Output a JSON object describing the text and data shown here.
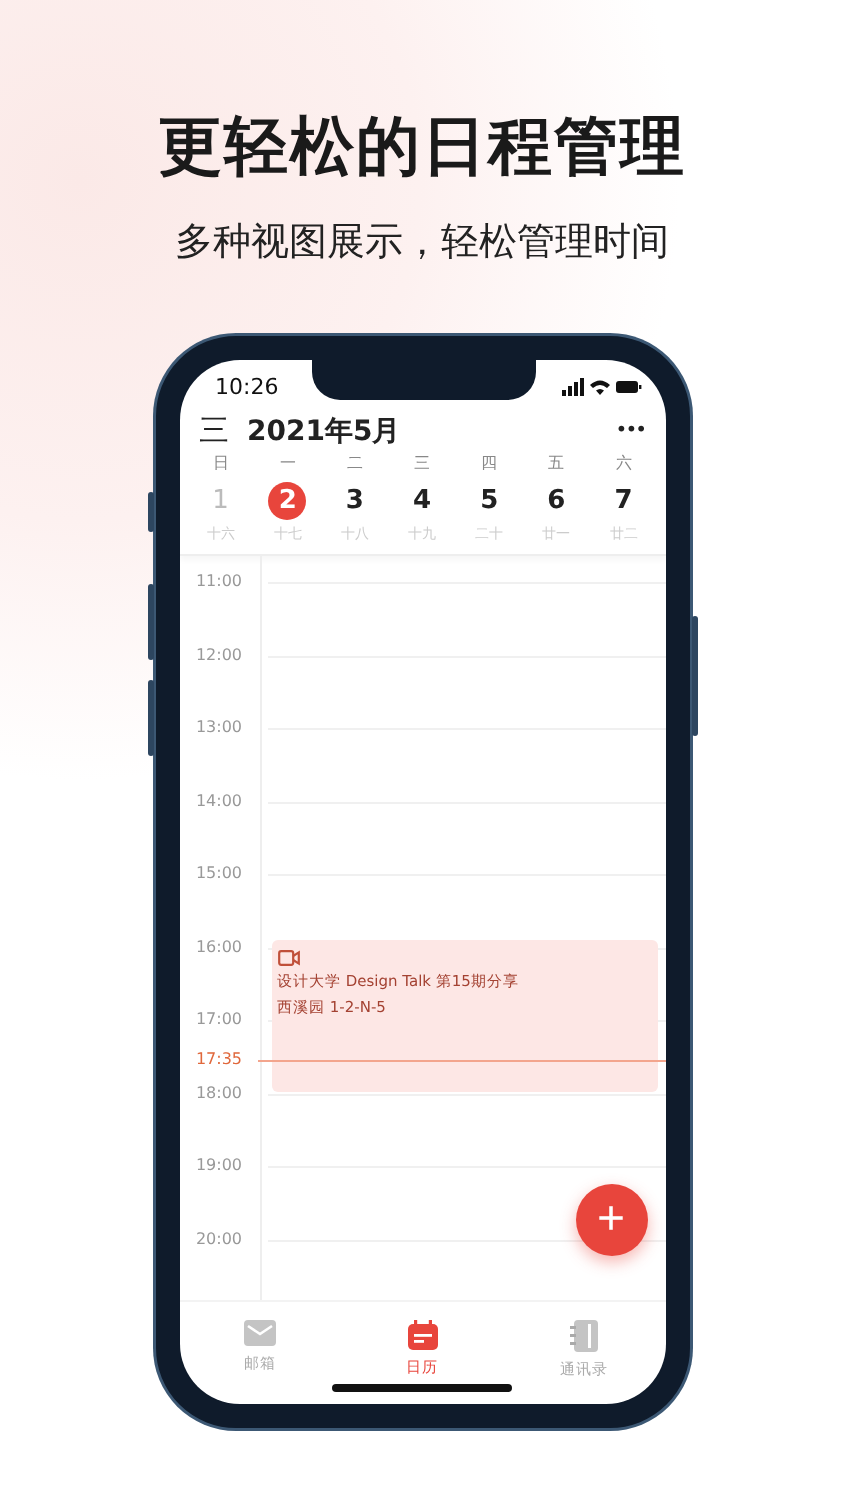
{
  "headline": "更轻松的日程管理",
  "subtitle": "多种视图展示，轻松管理时间",
  "status_bar": {
    "time": "10:26"
  },
  "header": {
    "menu": "三",
    "title": "2021年5月",
    "more": "•••"
  },
  "days": [
    {
      "weekday": "日",
      "date": "1",
      "lunar": "十六",
      "muted": true,
      "selected": false
    },
    {
      "weekday": "一",
      "date": "2",
      "lunar": "十七",
      "muted": false,
      "selected": true
    },
    {
      "weekday": "二",
      "date": "3",
      "lunar": "十八",
      "muted": false,
      "selected": false
    },
    {
      "weekday": "三",
      "date": "4",
      "lunar": "十九",
      "muted": false,
      "selected": false
    },
    {
      "weekday": "四",
      "date": "5",
      "lunar": "二十",
      "muted": false,
      "selected": false
    },
    {
      "weekday": "五",
      "date": "6",
      "lunar": "廿一",
      "muted": false,
      "selected": false
    },
    {
      "weekday": "六",
      "date": "7",
      "lunar": "廿二",
      "muted": false,
      "selected": false
    }
  ],
  "hours": [
    "11:00",
    "12:00",
    "13:00",
    "14:00",
    "15:00",
    "16:00",
    "17:00",
    "18:00",
    "19:00",
    "20:00"
  ],
  "event": {
    "title": "设计大学 Design Talk 第15期分享",
    "location": "西溪园 1-2-N-5"
  },
  "now": "17:35",
  "fab": "+",
  "tabs": [
    {
      "kind": "mail",
      "label": "邮箱",
      "selected": false
    },
    {
      "kind": "calendar",
      "label": "日历",
      "selected": true
    },
    {
      "kind": "contacts",
      "label": "通讯录",
      "selected": false
    }
  ]
}
